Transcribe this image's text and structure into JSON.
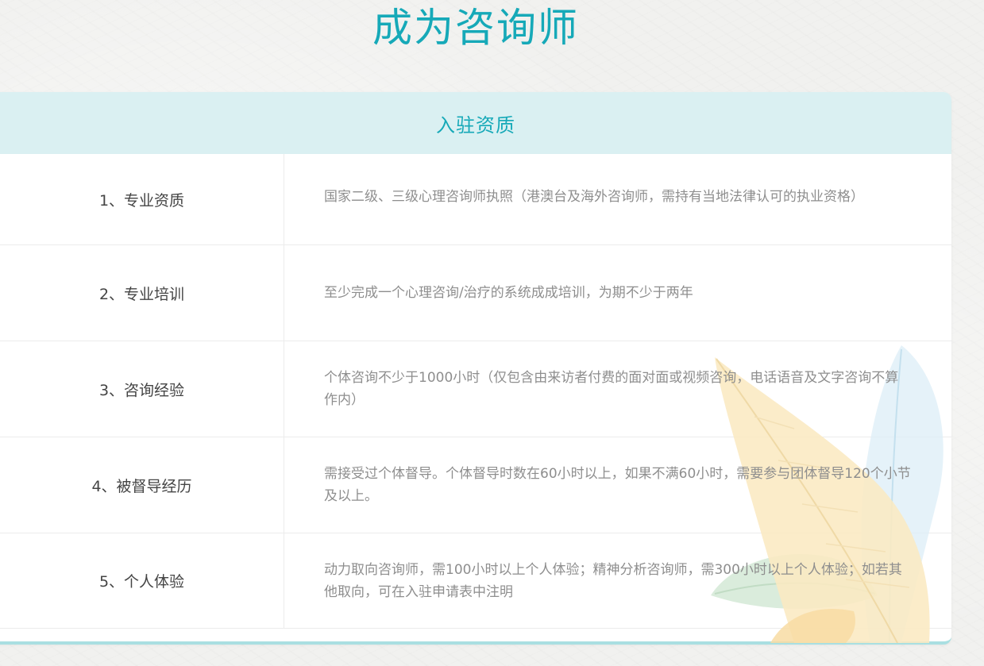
{
  "page": {
    "title": "成为咨询师"
  },
  "section": {
    "header": "入驻资质"
  },
  "requirements": [
    {
      "label": "1、专业资质",
      "desc": "国家二级、三级心理咨询师执照（港澳台及海外咨询师，需持有当地法律认可的执业资格）"
    },
    {
      "label": "2、专业培训",
      "desc": "至少完成一个心理咨询/治疗的系统成成培训，为期不少于两年"
    },
    {
      "label": "3、咨询经验",
      "desc": "个体咨询不少于1000小时（仅包含由来访者付费的面对面或视频咨询，电话语音及文字咨询不算作内）"
    },
    {
      "label": "4、被督导经历",
      "desc": "需接受过个体督导。个体督导时数在60小时以上，如果不满60小时，需要参与团体督导120个小节及以上。"
    },
    {
      "label": "5、个人体验",
      "desc": "动力取向咨询师，需100小时以上个人体验；精神分析咨询师，需300小时以上个人体验；如若其他取向，可在入驻申请表中注明"
    }
  ],
  "colors": {
    "accent": "#16a9b8",
    "header_bg": "#daf0f2",
    "card_border": "#a9dfe1",
    "label_text": "#444444",
    "desc_text": "#8e8e8e"
  },
  "decoration": {
    "icon": "leaf-illustration"
  }
}
